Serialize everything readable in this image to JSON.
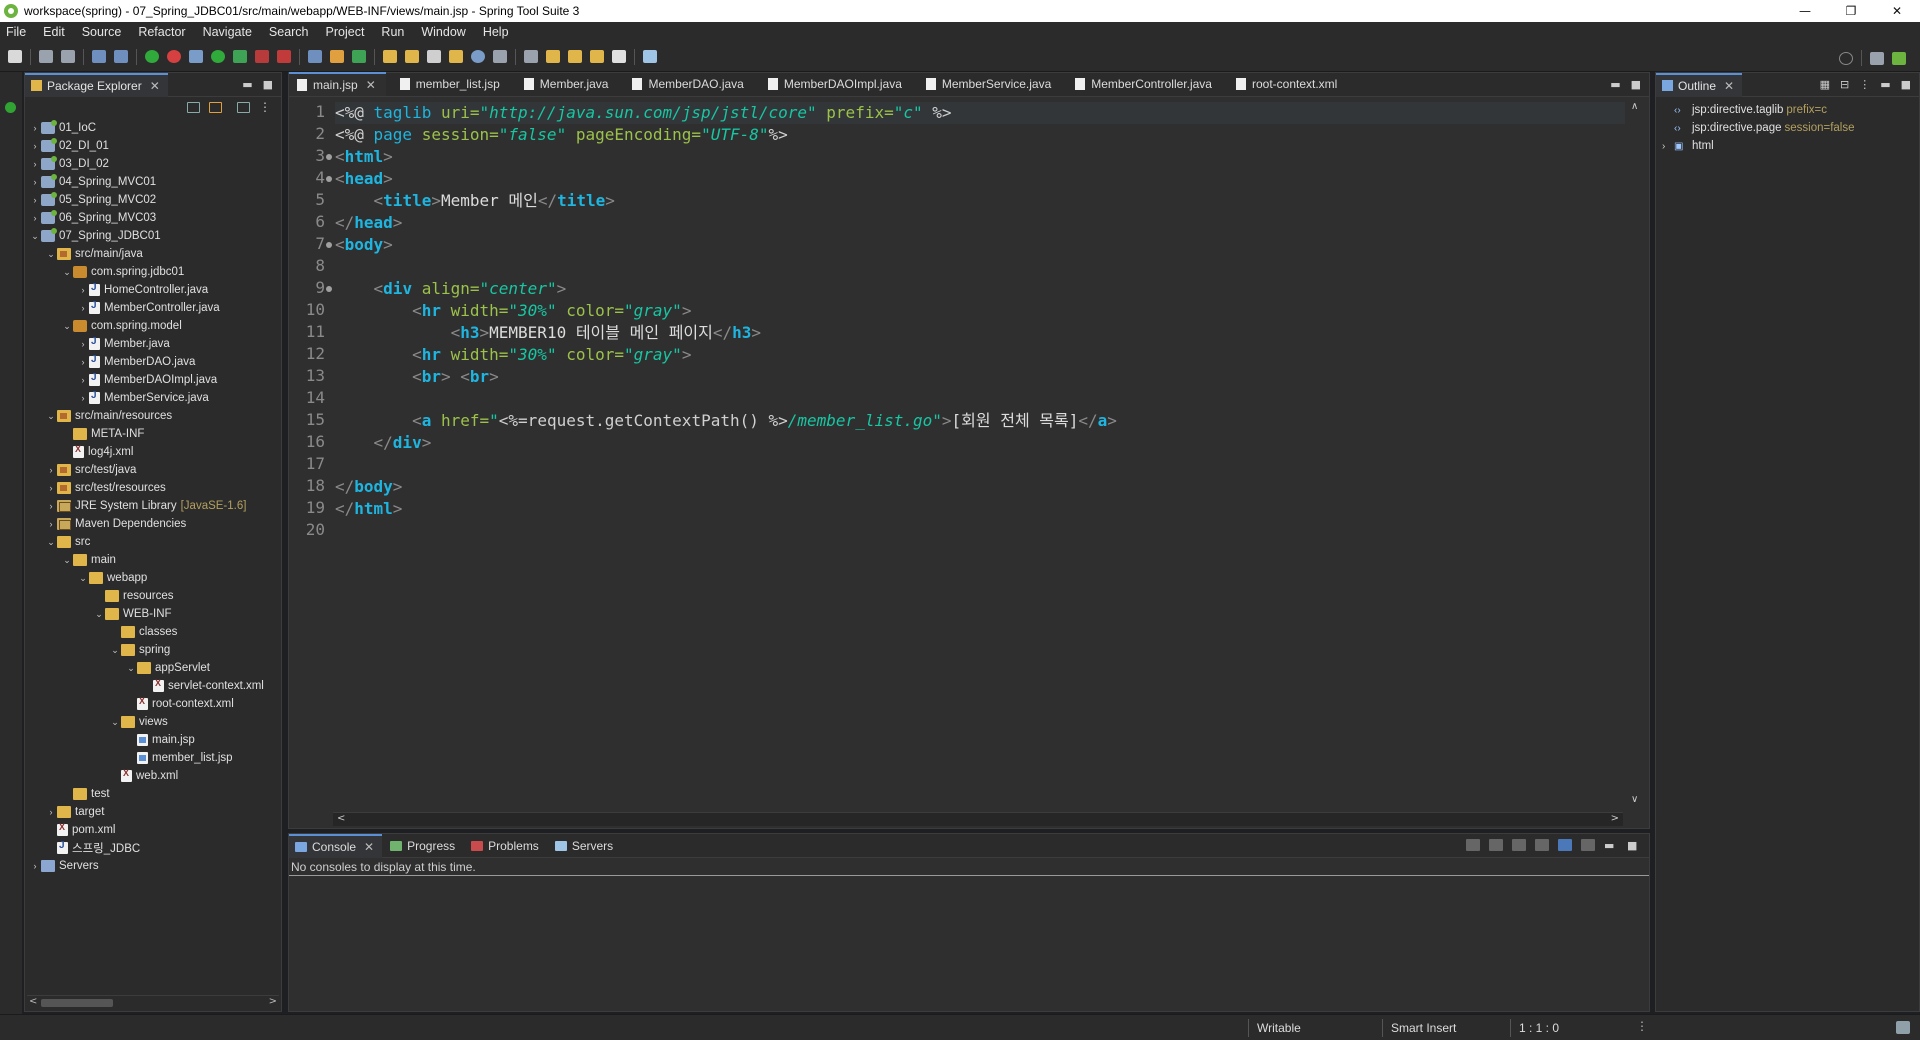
{
  "window": {
    "title": "workspace(spring) - 07_Spring_JDBC01/src/main/webapp/WEB-INF/views/main.jsp - Spring Tool Suite 3",
    "controls": [
      "—",
      "❐",
      "✕"
    ]
  },
  "menu": [
    "File",
    "Edit",
    "Source",
    "Refactor",
    "Navigate",
    "Search",
    "Project",
    "Run",
    "Window",
    "Help"
  ],
  "package_explorer": {
    "title": "Package Explorer",
    "tree": [
      {
        "label": "01_IoC",
        "depth": 0,
        "icon": "project",
        "arrow": ">"
      },
      {
        "label": "02_DI_01",
        "depth": 0,
        "icon": "project",
        "arrow": ">"
      },
      {
        "label": "03_DI_02",
        "depth": 0,
        "icon": "project",
        "arrow": ">"
      },
      {
        "label": "04_Spring_MVC01",
        "depth": 0,
        "icon": "project",
        "arrow": ">"
      },
      {
        "label": "05_Spring_MVC02",
        "depth": 0,
        "icon": "project",
        "arrow": ">"
      },
      {
        "label": "06_Spring_MVC03",
        "depth": 0,
        "icon": "project",
        "arrow": ">"
      },
      {
        "label": "07_Spring_JDBC01",
        "depth": 0,
        "icon": "project",
        "arrow": "v"
      },
      {
        "label": "src/main/java",
        "depth": 1,
        "icon": "srcfolder",
        "arrow": "v"
      },
      {
        "label": "com.spring.jdbc01",
        "depth": 2,
        "icon": "package",
        "arrow": "v"
      },
      {
        "label": "HomeController.java",
        "depth": 3,
        "icon": "java",
        "arrow": ">"
      },
      {
        "label": "MemberController.java",
        "depth": 3,
        "icon": "java",
        "arrow": ">"
      },
      {
        "label": "com.spring.model",
        "depth": 2,
        "icon": "package",
        "arrow": "v"
      },
      {
        "label": "Member.java",
        "depth": 3,
        "icon": "java",
        "arrow": ">"
      },
      {
        "label": "MemberDAO.java",
        "depth": 3,
        "icon": "java",
        "arrow": ">"
      },
      {
        "label": "MemberDAOImpl.java",
        "depth": 3,
        "icon": "java",
        "arrow": ">"
      },
      {
        "label": "MemberService.java",
        "depth": 3,
        "icon": "java",
        "arrow": ">"
      },
      {
        "label": "src/main/resources",
        "depth": 1,
        "icon": "srcfolder",
        "arrow": "v"
      },
      {
        "label": "META-INF",
        "depth": 2,
        "icon": "folder",
        "arrow": ""
      },
      {
        "label": "log4j.xml",
        "depth": 2,
        "icon": "xml",
        "arrow": ""
      },
      {
        "label": "src/test/java",
        "depth": 1,
        "icon": "srcfolder",
        "arrow": ">"
      },
      {
        "label": "src/test/resources",
        "depth": 1,
        "icon": "srcfolder",
        "arrow": ">"
      },
      {
        "label": "JRE System Library",
        "depth": 1,
        "icon": "lib",
        "arrow": ">",
        "deco": "[JavaSE-1.6]"
      },
      {
        "label": "Maven Dependencies",
        "depth": 1,
        "icon": "lib",
        "arrow": ">"
      },
      {
        "label": "src",
        "depth": 1,
        "icon": "folder",
        "arrow": "v"
      },
      {
        "label": "main",
        "depth": 2,
        "icon": "folder",
        "arrow": "v"
      },
      {
        "label": "webapp",
        "depth": 3,
        "icon": "folder",
        "arrow": "v"
      },
      {
        "label": "resources",
        "depth": 4,
        "icon": "folder",
        "arrow": ""
      },
      {
        "label": "WEB-INF",
        "depth": 4,
        "icon": "folder",
        "arrow": "v"
      },
      {
        "label": "classes",
        "depth": 5,
        "icon": "folder",
        "arrow": ""
      },
      {
        "label": "spring",
        "depth": 5,
        "icon": "folder",
        "arrow": "v"
      },
      {
        "label": "appServlet",
        "depth": 6,
        "icon": "folder",
        "arrow": "v"
      },
      {
        "label": "servlet-context.xml",
        "depth": 7,
        "icon": "xml",
        "arrow": ""
      },
      {
        "label": "root-context.xml",
        "depth": 6,
        "icon": "xml",
        "arrow": ""
      },
      {
        "label": "views",
        "depth": 5,
        "icon": "folder",
        "arrow": "v"
      },
      {
        "label": "main.jsp",
        "depth": 6,
        "icon": "jsp",
        "arrow": ""
      },
      {
        "label": "member_list.jsp",
        "depth": 6,
        "icon": "jsp",
        "arrow": ""
      },
      {
        "label": "web.xml",
        "depth": 5,
        "icon": "xml",
        "arrow": ""
      },
      {
        "label": "test",
        "depth": 2,
        "icon": "folder",
        "arrow": ""
      },
      {
        "label": "target",
        "depth": 1,
        "icon": "folder",
        "arrow": ">"
      },
      {
        "label": "pom.xml",
        "depth": 1,
        "icon": "xml",
        "arrow": ""
      },
      {
        "label": "스프링_JDBC",
        "depth": 1,
        "icon": "java",
        "arrow": ""
      },
      {
        "label": "Servers",
        "depth": 0,
        "icon": "server",
        "arrow": ">"
      }
    ]
  },
  "editor": {
    "tabs": [
      {
        "label": "main.jsp",
        "active": true
      },
      {
        "label": "member_list.jsp",
        "active": false
      },
      {
        "label": "Member.java",
        "active": false
      },
      {
        "label": "MemberDAO.java",
        "active": false
      },
      {
        "label": "MemberDAOImpl.java",
        "active": false
      },
      {
        "label": "MemberService.java",
        "active": false
      },
      {
        "label": "MemberController.java",
        "active": false
      },
      {
        "label": "root-context.xml",
        "active": false
      }
    ],
    "line_numbers": [
      "1",
      "2",
      "3",
      "4",
      "5",
      "6",
      "7",
      "8",
      "9",
      "10",
      "11",
      "12",
      "13",
      "14",
      "15",
      "16",
      "17",
      "18",
      "19",
      "20"
    ],
    "folded_lines": [
      "3",
      "4",
      "7",
      "9"
    ],
    "lines": [
      [
        {
          "c": "dl",
          "t": "<%@ "
        },
        {
          "c": "k",
          "t": "taglib "
        },
        {
          "c": "at",
          "t": "uri="
        },
        {
          "c": "st",
          "t": "\"http://java.sun.com/jsp/jstl/core\""
        },
        {
          "c": "at",
          "t": " prefix="
        },
        {
          "c": "st",
          "t": "\"c\""
        },
        {
          "c": "dl",
          "t": " %>"
        }
      ],
      [
        {
          "c": "dl",
          "t": "<%@ "
        },
        {
          "c": "k",
          "t": "page "
        },
        {
          "c": "at",
          "t": "session="
        },
        {
          "c": "st",
          "t": "\"false\""
        },
        {
          "c": "at",
          "t": " pageEncoding="
        },
        {
          "c": "st",
          "t": "\"UTF-8\""
        },
        {
          "c": "dl",
          "t": "%>"
        }
      ],
      [
        {
          "c": "br",
          "t": "<"
        },
        {
          "c": "tg",
          "t": "html"
        },
        {
          "c": "br",
          "t": ">"
        }
      ],
      [
        {
          "c": "br",
          "t": "<"
        },
        {
          "c": "tg",
          "t": "head"
        },
        {
          "c": "br",
          "t": ">"
        }
      ],
      [
        {
          "c": "tx",
          "t": "    "
        },
        {
          "c": "br",
          "t": "<"
        },
        {
          "c": "tg",
          "t": "title"
        },
        {
          "c": "br",
          "t": ">"
        },
        {
          "c": "tx",
          "t": "Member 메인"
        },
        {
          "c": "br",
          "t": "</"
        },
        {
          "c": "tg",
          "t": "title"
        },
        {
          "c": "br",
          "t": ">"
        }
      ],
      [
        {
          "c": "br",
          "t": "</"
        },
        {
          "c": "tg",
          "t": "head"
        },
        {
          "c": "br",
          "t": ">"
        }
      ],
      [
        {
          "c": "br",
          "t": "<"
        },
        {
          "c": "tg",
          "t": "body"
        },
        {
          "c": "br",
          "t": ">"
        }
      ],
      [],
      [
        {
          "c": "tx",
          "t": "    "
        },
        {
          "c": "br",
          "t": "<"
        },
        {
          "c": "tg",
          "t": "div"
        },
        {
          "c": "at",
          "t": " align="
        },
        {
          "c": "st",
          "t": "\"center\""
        },
        {
          "c": "br",
          "t": ">"
        }
      ],
      [
        {
          "c": "tx",
          "t": "        "
        },
        {
          "c": "br",
          "t": "<"
        },
        {
          "c": "tg",
          "t": "hr"
        },
        {
          "c": "at",
          "t": " width="
        },
        {
          "c": "st",
          "t": "\"30%\""
        },
        {
          "c": "at",
          "t": " color="
        },
        {
          "c": "st",
          "t": "\"gray\""
        },
        {
          "c": "br",
          "t": ">"
        }
      ],
      [
        {
          "c": "tx",
          "t": "            "
        },
        {
          "c": "br",
          "t": "<"
        },
        {
          "c": "tg",
          "t": "h3"
        },
        {
          "c": "br",
          "t": ">"
        },
        {
          "c": "tx",
          "t": "MEMBER10 테이블 메인 페이지"
        },
        {
          "c": "br",
          "t": "</"
        },
        {
          "c": "tg",
          "t": "h3"
        },
        {
          "c": "br",
          "t": ">"
        }
      ],
      [
        {
          "c": "tx",
          "t": "        "
        },
        {
          "c": "br",
          "t": "<"
        },
        {
          "c": "tg",
          "t": "hr"
        },
        {
          "c": "at",
          "t": " width="
        },
        {
          "c": "st",
          "t": "\"30%\""
        },
        {
          "c": "at",
          "t": " color="
        },
        {
          "c": "st",
          "t": "\"gray\""
        },
        {
          "c": "br",
          "t": ">"
        }
      ],
      [
        {
          "c": "tx",
          "t": "        "
        },
        {
          "c": "br",
          "t": "<"
        },
        {
          "c": "tg",
          "t": "br"
        },
        {
          "c": "br",
          "t": "> <"
        },
        {
          "c": "tg",
          "t": "br"
        },
        {
          "c": "br",
          "t": ">"
        }
      ],
      [],
      [
        {
          "c": "tx",
          "t": "        "
        },
        {
          "c": "br",
          "t": "<"
        },
        {
          "c": "tg",
          "t": "a"
        },
        {
          "c": "at",
          "t": " href="
        },
        {
          "c": "st",
          "t": "\""
        },
        {
          "c": "dl",
          "t": "<%=request.getContextPath() %>"
        },
        {
          "c": "st",
          "t": "/member_list.go\""
        },
        {
          "c": "br",
          "t": ">"
        },
        {
          "c": "tx",
          "t": "[회원 전체 목록]"
        },
        {
          "c": "br",
          "t": "</"
        },
        {
          "c": "tg",
          "t": "a"
        },
        {
          "c": "br",
          "t": ">"
        }
      ],
      [
        {
          "c": "tx",
          "t": "    "
        },
        {
          "c": "br",
          "t": "</"
        },
        {
          "c": "tg",
          "t": "div"
        },
        {
          "c": "br",
          "t": ">"
        }
      ],
      [],
      [
        {
          "c": "br",
          "t": "</"
        },
        {
          "c": "tg",
          "t": "body"
        },
        {
          "c": "br",
          "t": ">"
        }
      ],
      [
        {
          "c": "br",
          "t": "</"
        },
        {
          "c": "tg",
          "t": "html"
        },
        {
          "c": "br",
          "t": ">"
        }
      ],
      []
    ]
  },
  "console": {
    "tabs": [
      {
        "label": "Console",
        "active": true
      },
      {
        "label": "Progress",
        "active": false
      },
      {
        "label": "Problems",
        "active": false
      },
      {
        "label": "Servers",
        "active": false
      }
    ],
    "message": "No consoles to display at this time."
  },
  "outline": {
    "title": "Outline",
    "items": [
      {
        "label": "jsp:directive.taglib",
        "attr": "prefix=c",
        "arrow": ""
      },
      {
        "label": "jsp:directive.page",
        "attr": "session=false",
        "arrow": ""
      },
      {
        "label": "html",
        "attr": "",
        "arrow": ">"
      }
    ]
  },
  "status": {
    "writable": "Writable",
    "insert_mode": "Smart Insert",
    "position": "1 : 1 : 0"
  },
  "colors": {
    "accent": "#5b8fd6",
    "editor_bg": "#2f2f2f",
    "keyword": "#1eb5e0",
    "attribute": "#9cc24a",
    "string": "#17c6a3"
  }
}
